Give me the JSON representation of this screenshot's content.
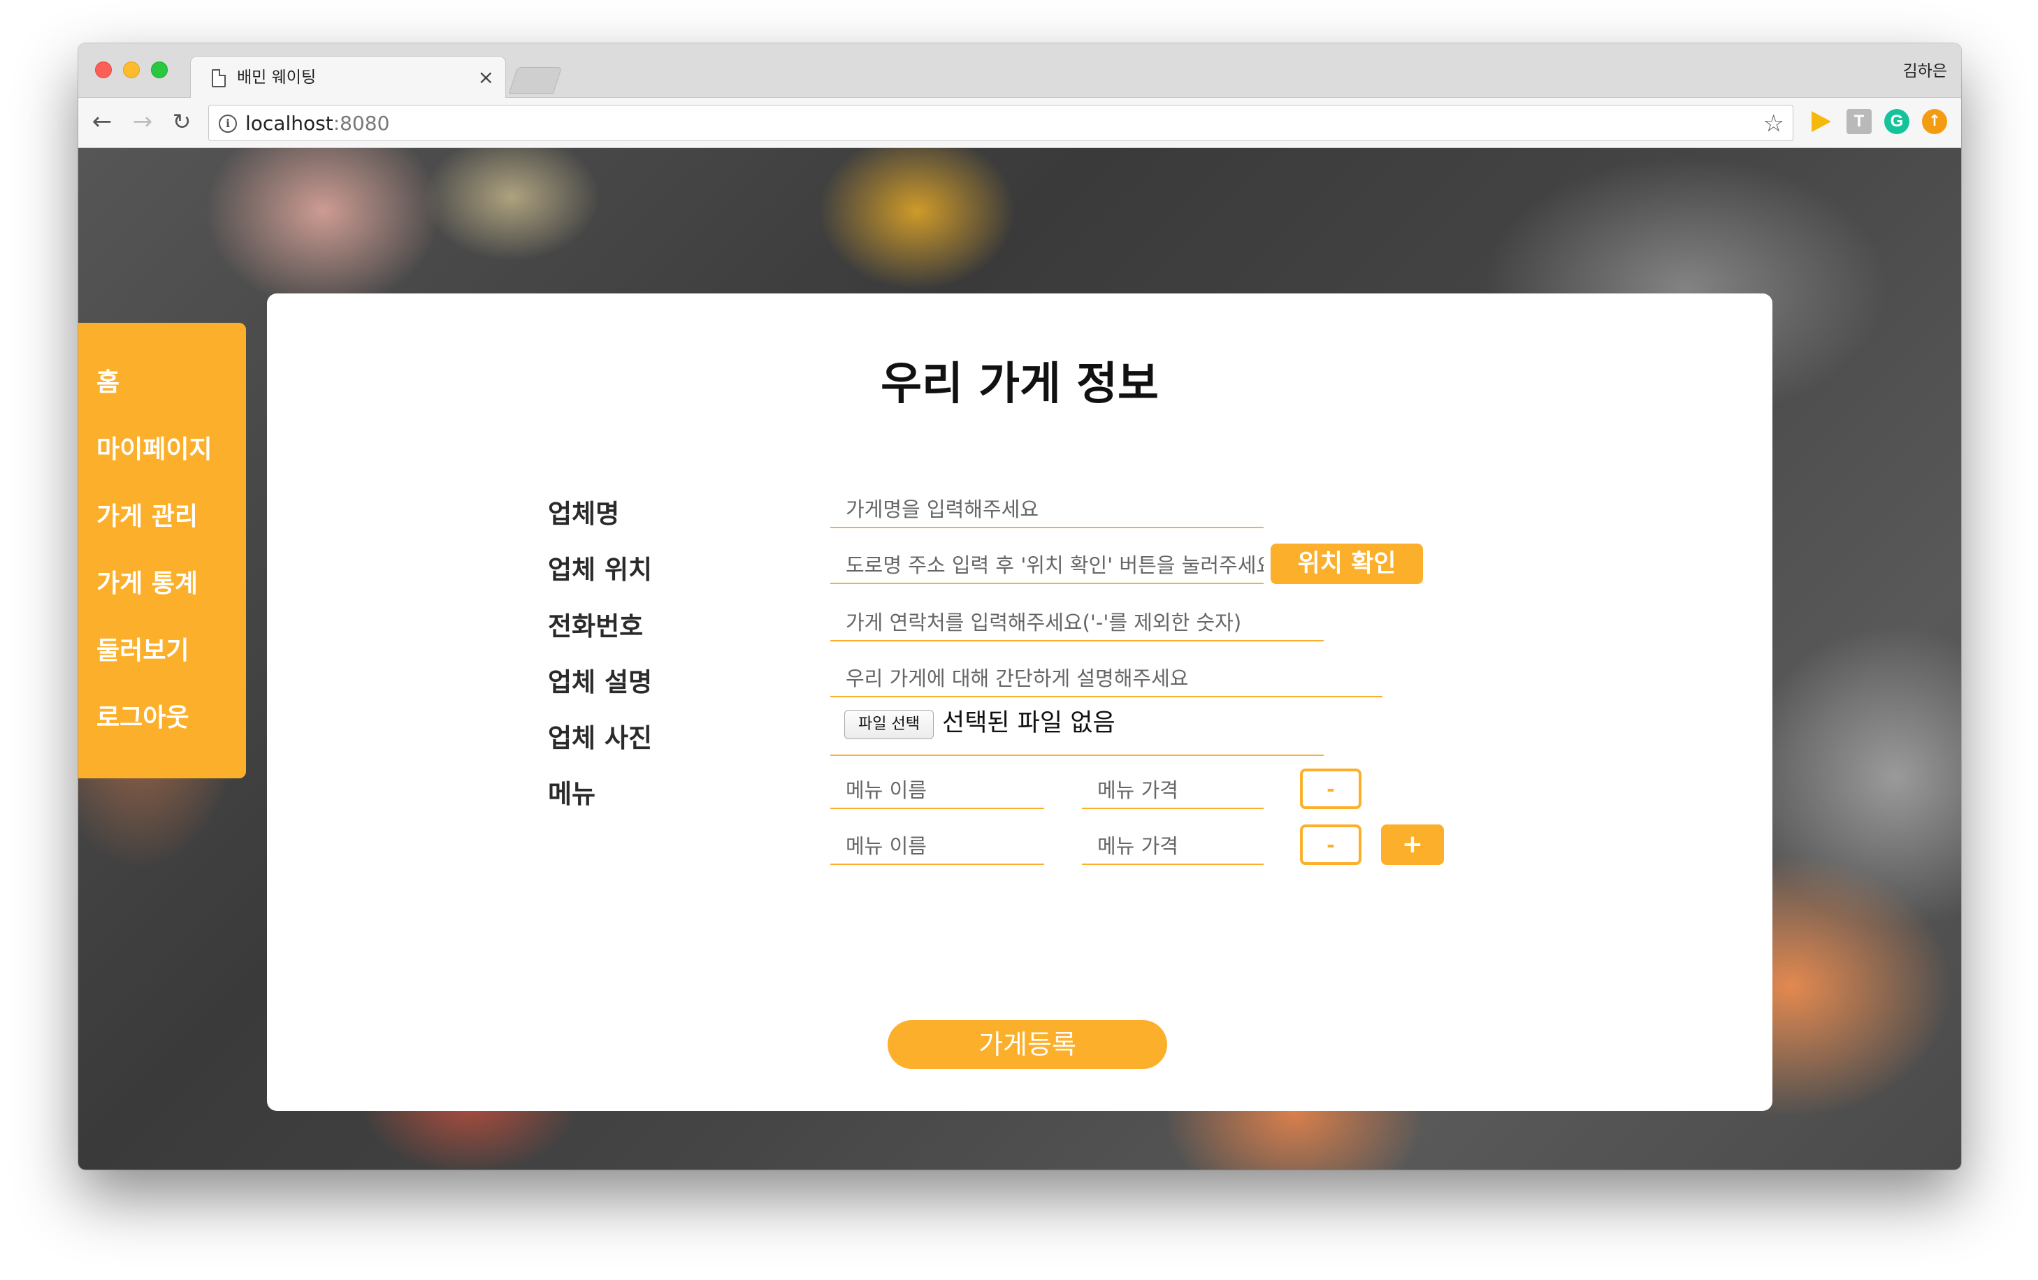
{
  "browser": {
    "tab_title": "배민 웨이팅",
    "tab_close": "×",
    "profile_name": "김하은",
    "url_host": "localhost",
    "url_port": ":8080",
    "nav_back": "←",
    "nav_forward": "→",
    "nav_reload": "↻",
    "info_glyph": "i",
    "star_glyph": "☆",
    "extensions": [
      {
        "name": "play-extension-icon",
        "color": "#f5b90d"
      },
      {
        "name": "t-extension-icon",
        "glyph": "T",
        "color": "#b9b9b9"
      },
      {
        "name": "grammarly-extension-icon",
        "glyph": "G",
        "color": "#15c39a"
      },
      {
        "name": "upload-extension-icon",
        "glyph": "↑",
        "color": "#f39c12"
      }
    ]
  },
  "sidebar": {
    "items": [
      {
        "label": "홈"
      },
      {
        "label": "마이페이지"
      },
      {
        "label": "가게 관리"
      },
      {
        "label": "가게 통계"
      },
      {
        "label": "둘러보기"
      },
      {
        "label": "로그아웃"
      }
    ]
  },
  "form": {
    "title": "우리 가게 정보",
    "labels": {
      "name": "업체명",
      "location": "업체 위치",
      "phone": "전화번호",
      "description": "업체 설명",
      "photo": "업체 사진",
      "menu": "메뉴"
    },
    "placeholders": {
      "name": "가게명을 입력해주세요",
      "location": "도로명 주소 입력 후 '위치 확인' 버튼을 눌러주세요",
      "phone": "가게 연락처를 입력해주세요('-'를 제외한 숫자)",
      "description": "우리 가게에 대해 간단하게 설명해주세요",
      "menu_name": "메뉴 이름",
      "menu_price": "메뉴 가격"
    },
    "location_button": "위치 확인",
    "file_button": "파일 선택",
    "file_status": "선택된 파일 없음",
    "menu_rows": [
      {
        "remove_label": "-"
      },
      {
        "remove_label": "-"
      }
    ],
    "add_label": "+",
    "submit_label": "가게등록"
  },
  "colors": {
    "accent": "#fcaf2a",
    "card_bg": "#ffffff",
    "label_text": "#2a2a2a"
  }
}
